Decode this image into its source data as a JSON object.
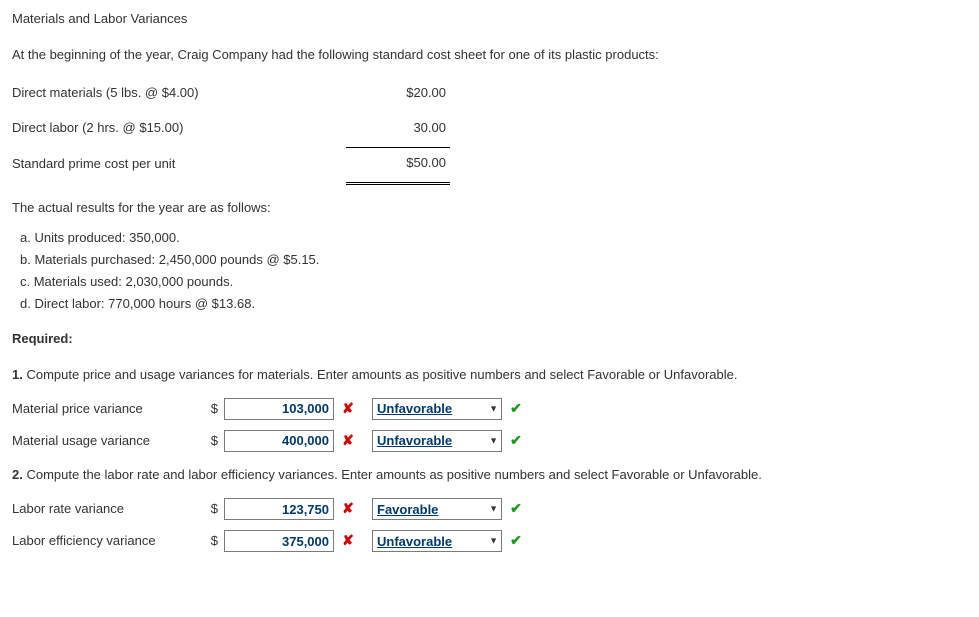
{
  "title": "Materials and Labor Variances",
  "intro": "At the beginning of the year, Craig Company had the following standard cost sheet for one of its plastic products:",
  "cost_sheet": {
    "rows": [
      {
        "label": "Direct materials (5 lbs. @ $4.00)",
        "amount": "$20.00"
      },
      {
        "label": "Direct labor (2 hrs. @ $15.00)",
        "amount": "30.00"
      },
      {
        "label": "Standard prime cost per unit",
        "amount": "$50.00"
      }
    ]
  },
  "results_intro": "The actual results for the year are as follows:",
  "results": [
    "a. Units produced: 350,000.",
    "b. Materials purchased: 2,450,000 pounds @ $5.15.",
    "c. Materials used: 2,030,000 pounds.",
    "d. Direct labor: 770,000 hours @ $13.68."
  ],
  "required_label": "Required:",
  "q1": {
    "num": "1.",
    "text": "Compute price and usage variances for materials. Enter amounts as positive numbers and select Favorable or Unfavorable.",
    "rows": [
      {
        "label": "Material price variance",
        "amount": "103,000",
        "amount_mark": "✘",
        "select": "Unfavorable",
        "select_mark": "✔"
      },
      {
        "label": "Material usage variance",
        "amount": "400,000",
        "amount_mark": "✘",
        "select": "Unfavorable",
        "select_mark": "✔"
      }
    ]
  },
  "q2": {
    "num": "2.",
    "text": "Compute the labor rate and labor efficiency variances. Enter amounts as positive numbers and select Favorable or Unfavorable.",
    "rows": [
      {
        "label": "Labor rate variance",
        "amount": "123,750",
        "amount_mark": "✘",
        "select": "Favorable",
        "select_mark": "✔"
      },
      {
        "label": "Labor efficiency variance",
        "amount": "375,000",
        "amount_mark": "✘",
        "select": "Unfavorable",
        "select_mark": "✔"
      }
    ]
  },
  "symbols": {
    "dollar": "$",
    "caret": "▼"
  }
}
